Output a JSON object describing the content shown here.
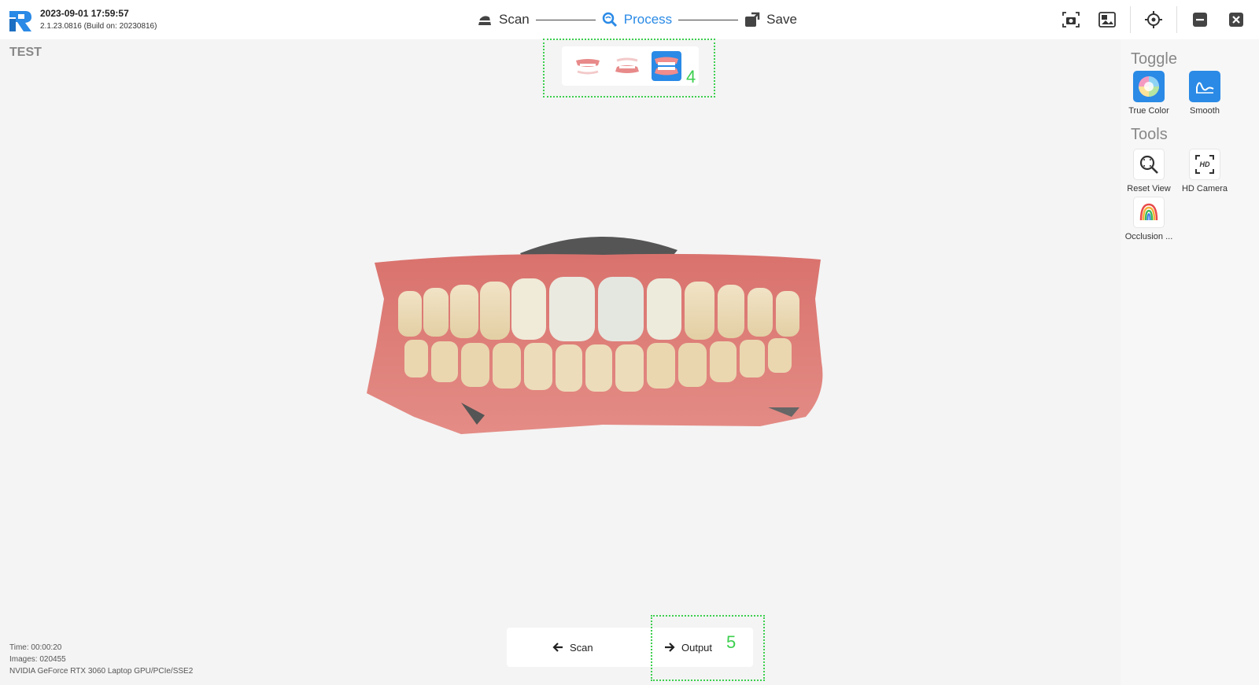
{
  "header": {
    "datetime": "2023-09-01 17:59:57",
    "version": "2.1.23.0816 (Build on: 20230816)"
  },
  "workflow": {
    "steps": [
      {
        "label": "Scan",
        "icon": "scanner-icon",
        "active": false
      },
      {
        "label": "Process",
        "icon": "process-search-icon",
        "active": true
      },
      {
        "label": "Save",
        "icon": "save-export-icon",
        "active": false
      }
    ]
  },
  "top_actions": [
    "screenshot-icon",
    "image-gallery-icon",
    "locate-target-icon",
    "minimize-icon",
    "close-icon"
  ],
  "project": {
    "name": "TEST"
  },
  "jaw_selector": {
    "items": [
      "upper-jaw-icon",
      "lower-jaw-icon",
      "both-jaws-icon"
    ],
    "selected_index": 2,
    "callout": "4"
  },
  "right_panel": {
    "toggle_title": "Toggle",
    "toggles": [
      {
        "label": "True Color",
        "icon": "color-wheel-icon",
        "on": true
      },
      {
        "label": "Smooth",
        "icon": "smooth-curve-icon",
        "on": true
      }
    ],
    "tools_title": "Tools",
    "tools": [
      {
        "label": "Reset View",
        "icon": "zoom-reset-icon"
      },
      {
        "label": "HD Camera",
        "icon": "hd-camera-icon"
      },
      {
        "label": "Occlusion ...",
        "icon": "occlusion-rainbow-icon"
      }
    ]
  },
  "bottom": {
    "back_label": "Scan",
    "next_label": "Output",
    "callout": "5"
  },
  "status": {
    "time": "Time: 00:00:20",
    "images": "Images: 020455",
    "gpu": "NVIDIA GeForce RTX 3060 Laptop GPU/PCIe/SSE2"
  },
  "colors": {
    "accent": "#2a8ae6",
    "callout": "#3ccf4e",
    "background": "#f4f4f4"
  }
}
